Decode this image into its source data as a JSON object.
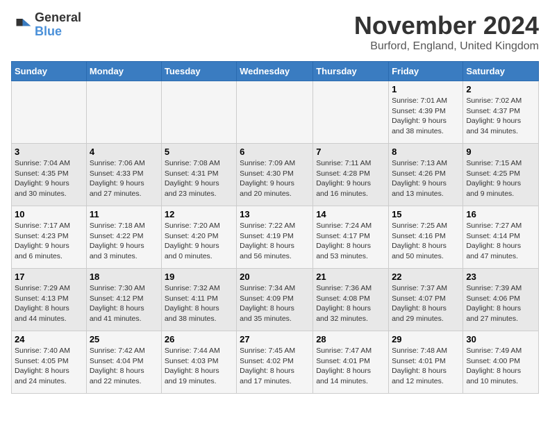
{
  "logo": {
    "text_general": "General",
    "text_blue": "Blue"
  },
  "title": "November 2024",
  "location": "Burford, England, United Kingdom",
  "headers": [
    "Sunday",
    "Monday",
    "Tuesday",
    "Wednesday",
    "Thursday",
    "Friday",
    "Saturday"
  ],
  "weeks": [
    [
      {
        "day": "",
        "info": ""
      },
      {
        "day": "",
        "info": ""
      },
      {
        "day": "",
        "info": ""
      },
      {
        "day": "",
        "info": ""
      },
      {
        "day": "",
        "info": ""
      },
      {
        "day": "1",
        "info": "Sunrise: 7:01 AM\nSunset: 4:39 PM\nDaylight: 9 hours\nand 38 minutes."
      },
      {
        "day": "2",
        "info": "Sunrise: 7:02 AM\nSunset: 4:37 PM\nDaylight: 9 hours\nand 34 minutes."
      }
    ],
    [
      {
        "day": "3",
        "info": "Sunrise: 7:04 AM\nSunset: 4:35 PM\nDaylight: 9 hours\nand 30 minutes."
      },
      {
        "day": "4",
        "info": "Sunrise: 7:06 AM\nSunset: 4:33 PM\nDaylight: 9 hours\nand 27 minutes."
      },
      {
        "day": "5",
        "info": "Sunrise: 7:08 AM\nSunset: 4:31 PM\nDaylight: 9 hours\nand 23 minutes."
      },
      {
        "day": "6",
        "info": "Sunrise: 7:09 AM\nSunset: 4:30 PM\nDaylight: 9 hours\nand 20 minutes."
      },
      {
        "day": "7",
        "info": "Sunrise: 7:11 AM\nSunset: 4:28 PM\nDaylight: 9 hours\nand 16 minutes."
      },
      {
        "day": "8",
        "info": "Sunrise: 7:13 AM\nSunset: 4:26 PM\nDaylight: 9 hours\nand 13 minutes."
      },
      {
        "day": "9",
        "info": "Sunrise: 7:15 AM\nSunset: 4:25 PM\nDaylight: 9 hours\nand 9 minutes."
      }
    ],
    [
      {
        "day": "10",
        "info": "Sunrise: 7:17 AM\nSunset: 4:23 PM\nDaylight: 9 hours\nand 6 minutes."
      },
      {
        "day": "11",
        "info": "Sunrise: 7:18 AM\nSunset: 4:22 PM\nDaylight: 9 hours\nand 3 minutes."
      },
      {
        "day": "12",
        "info": "Sunrise: 7:20 AM\nSunset: 4:20 PM\nDaylight: 9 hours\nand 0 minutes."
      },
      {
        "day": "13",
        "info": "Sunrise: 7:22 AM\nSunset: 4:19 PM\nDaylight: 8 hours\nand 56 minutes."
      },
      {
        "day": "14",
        "info": "Sunrise: 7:24 AM\nSunset: 4:17 PM\nDaylight: 8 hours\nand 53 minutes."
      },
      {
        "day": "15",
        "info": "Sunrise: 7:25 AM\nSunset: 4:16 PM\nDaylight: 8 hours\nand 50 minutes."
      },
      {
        "day": "16",
        "info": "Sunrise: 7:27 AM\nSunset: 4:14 PM\nDaylight: 8 hours\nand 47 minutes."
      }
    ],
    [
      {
        "day": "17",
        "info": "Sunrise: 7:29 AM\nSunset: 4:13 PM\nDaylight: 8 hours\nand 44 minutes."
      },
      {
        "day": "18",
        "info": "Sunrise: 7:30 AM\nSunset: 4:12 PM\nDaylight: 8 hours\nand 41 minutes."
      },
      {
        "day": "19",
        "info": "Sunrise: 7:32 AM\nSunset: 4:11 PM\nDaylight: 8 hours\nand 38 minutes."
      },
      {
        "day": "20",
        "info": "Sunrise: 7:34 AM\nSunset: 4:09 PM\nDaylight: 8 hours\nand 35 minutes."
      },
      {
        "day": "21",
        "info": "Sunrise: 7:36 AM\nSunset: 4:08 PM\nDaylight: 8 hours\nand 32 minutes."
      },
      {
        "day": "22",
        "info": "Sunrise: 7:37 AM\nSunset: 4:07 PM\nDaylight: 8 hours\nand 29 minutes."
      },
      {
        "day": "23",
        "info": "Sunrise: 7:39 AM\nSunset: 4:06 PM\nDaylight: 8 hours\nand 27 minutes."
      }
    ],
    [
      {
        "day": "24",
        "info": "Sunrise: 7:40 AM\nSunset: 4:05 PM\nDaylight: 8 hours\nand 24 minutes."
      },
      {
        "day": "25",
        "info": "Sunrise: 7:42 AM\nSunset: 4:04 PM\nDaylight: 8 hours\nand 22 minutes."
      },
      {
        "day": "26",
        "info": "Sunrise: 7:44 AM\nSunset: 4:03 PM\nDaylight: 8 hours\nand 19 minutes."
      },
      {
        "day": "27",
        "info": "Sunrise: 7:45 AM\nSunset: 4:02 PM\nDaylight: 8 hours\nand 17 minutes."
      },
      {
        "day": "28",
        "info": "Sunrise: 7:47 AM\nSunset: 4:01 PM\nDaylight: 8 hours\nand 14 minutes."
      },
      {
        "day": "29",
        "info": "Sunrise: 7:48 AM\nSunset: 4:01 PM\nDaylight: 8 hours\nand 12 minutes."
      },
      {
        "day": "30",
        "info": "Sunrise: 7:49 AM\nSunset: 4:00 PM\nDaylight: 8 hours\nand 10 minutes."
      }
    ]
  ]
}
